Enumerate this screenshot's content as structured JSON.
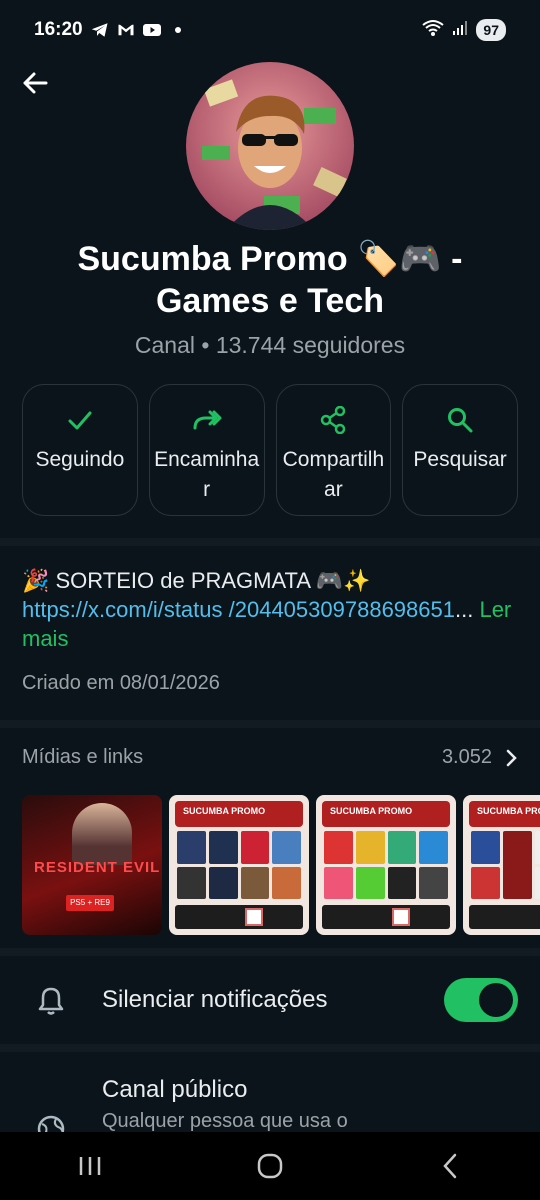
{
  "status_bar": {
    "time": "16:20",
    "notification_icons": [
      "telegram-icon",
      "gmail-icon",
      "youtube-icon",
      "dot-icon"
    ],
    "battery": "97"
  },
  "channel": {
    "title": "Sucumba Promo 🏷️🎮  - Games e Tech",
    "subtitle": "Canal • 13.744 seguidores"
  },
  "actions": [
    {
      "label": "Seguindo",
      "icon": "check-icon"
    },
    {
      "label": "Encaminhar",
      "icon": "forward-icon"
    },
    {
      "label": "Compartilhar",
      "icon": "share-icon"
    },
    {
      "label": "Pesquisar",
      "icon": "search-icon"
    }
  ],
  "description": {
    "text": "🎉 SORTEIO de PRAGMATA 🎮✨",
    "link": "https://x.com/i/status/2044053097886986516",
    "link_display": "https://x.com/i/status /204405309788698651",
    "ellipsis": "...",
    "more": "Ler mais",
    "created": "Criado em 08/01/2026"
  },
  "media": {
    "title": "Mídias e links",
    "count": "3.052",
    "thumbnails": [
      {
        "type": "resident-evil",
        "text": "RESIDENT EVIL",
        "badge": "PS5 + RE9"
      },
      {
        "type": "promo",
        "header": "SUCUMBA PROMO"
      },
      {
        "type": "promo",
        "header": "SUCUMBA PROMO"
      },
      {
        "type": "promo",
        "header": "SUCUMBA PROMO"
      }
    ]
  },
  "settings": {
    "mute_label": "Silenciar notificações",
    "mute_on": true,
    "public_title": "Canal público",
    "public_sub": "Qualquer pessoa que usa o"
  },
  "colors": {
    "background": "#0b141a",
    "accent_green": "#21c063",
    "link_blue": "#53bdeb",
    "secondary_text": "#9ba3a8"
  }
}
